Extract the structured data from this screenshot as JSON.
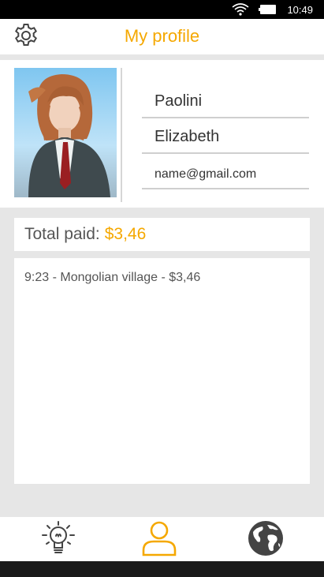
{
  "status_bar": {
    "time": "10:49",
    "icons": [
      "wifi-icon",
      "battery-icon"
    ]
  },
  "header": {
    "title": "My profile",
    "settings_icon": "gear-icon"
  },
  "profile": {
    "last_name": "Paolini",
    "first_name": "Elizabeth",
    "email": "name@gmail.com",
    "avatar": "profile-avatar"
  },
  "total": {
    "label": "Total paid:",
    "amount": "$3,46"
  },
  "history": [
    {
      "text": "9:23 - Mongolian village - $3,46"
    }
  ],
  "bottom_nav": {
    "items": [
      {
        "icon": "lightbulb-icon",
        "active": false
      },
      {
        "icon": "user-icon",
        "active": true
      },
      {
        "icon": "globe-icon",
        "active": false
      }
    ]
  },
  "colors": {
    "accent": "#f5a800",
    "icon": "#444444",
    "background": "#e6e6e6"
  }
}
